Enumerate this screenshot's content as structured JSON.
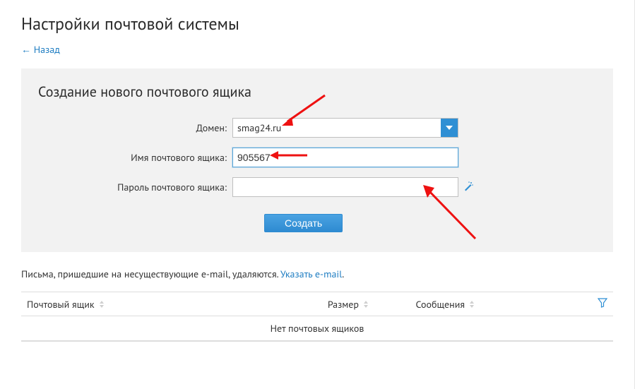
{
  "page_title": "Настройки почтовой системы",
  "back_link": "← Назад",
  "panel": {
    "title": "Создание нового почтового ящика",
    "labels": {
      "domain": "Домен:",
      "mailbox_name": "Имя почтового ящика:",
      "mailbox_password": "Пароль почтового ящика:"
    },
    "fields": {
      "domain_value": "smag24.ru",
      "mailbox_name_value": "905567",
      "mailbox_password_value": ""
    },
    "create_button": "Создать"
  },
  "note_text": "Письма, пришедшие на несуществующие e-mail, удаляются. ",
  "note_link_text": "Указать e-mail",
  "note_trailing": ".",
  "table": {
    "columns": {
      "mailbox": "Почтовый ящик",
      "size": "Размер",
      "messages": "Сообщения"
    },
    "empty_text": "Нет почтовых ящиков"
  }
}
